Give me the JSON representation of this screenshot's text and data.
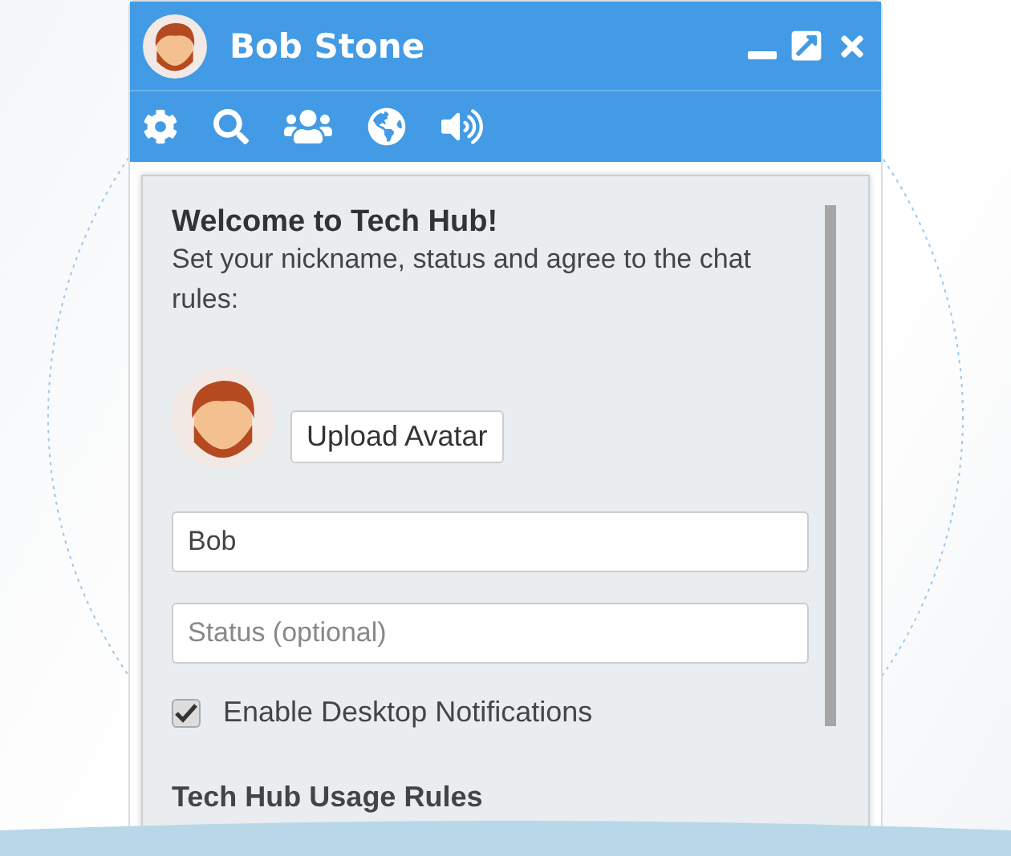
{
  "header": {
    "title": "Bob Stone"
  },
  "welcome": {
    "title": "Welcome to Tech Hub!",
    "text": "Set your nickname, status and agree to the chat rules:"
  },
  "upload_button": "Upload Avatar",
  "nickname_field": {
    "value": "Bob"
  },
  "status_field": {
    "placeholder": "Status (optional)"
  },
  "notifications": {
    "label": "Enable Desktop Notifications",
    "checked": true
  },
  "rules_heading": "Tech Hub Usage Rules"
}
